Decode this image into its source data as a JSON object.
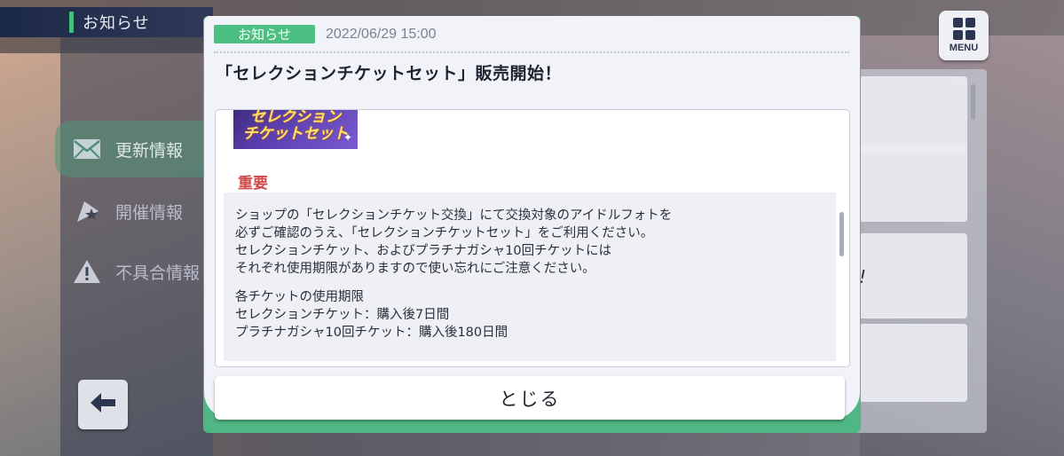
{
  "header": {
    "title": "お知らせ"
  },
  "nav": {
    "items": [
      {
        "label": "更新情報",
        "icon": "envelope-icon",
        "active": true
      },
      {
        "label": "開催情報",
        "icon": "flag-star-icon",
        "active": false
      },
      {
        "label": "不具合情報",
        "icon": "warning-icon",
        "active": false
      }
    ],
    "back_icon": "arrow-left-icon"
  },
  "menu": {
    "label": "MENU",
    "icon": "grid-icon"
  },
  "right_list": {
    "partial_text": "!"
  },
  "modal": {
    "badge": "お知らせ",
    "date": "2022/06/29 15:00",
    "title": "「セレクションチケットセット」販売開始！",
    "banner": {
      "line1": "セレクション",
      "line2": "チケットセット"
    },
    "important_label": "重要",
    "notice_lines": [
      "ショップの「セレクションチケット交換」にて交換対象のアイドルフォトを",
      "必ずご確認のうえ、「セレクションチケットセット」をご利用ください。",
      "セレクションチケット、およびプラチナガシャ10回チケットには",
      "それぞれ使用期限がありますので使い忘れにご注意ください。"
    ],
    "expiry_lines": [
      "各チケットの使用期限",
      "セレクションチケット：購入後7日間",
      "プラチナガシャ10回チケット：購入後180日間"
    ],
    "close_label": "とじる"
  },
  "colors": {
    "accent_green": "#4cbf82",
    "important_red": "#d04a4a",
    "header_navy": "#1e2a50"
  }
}
